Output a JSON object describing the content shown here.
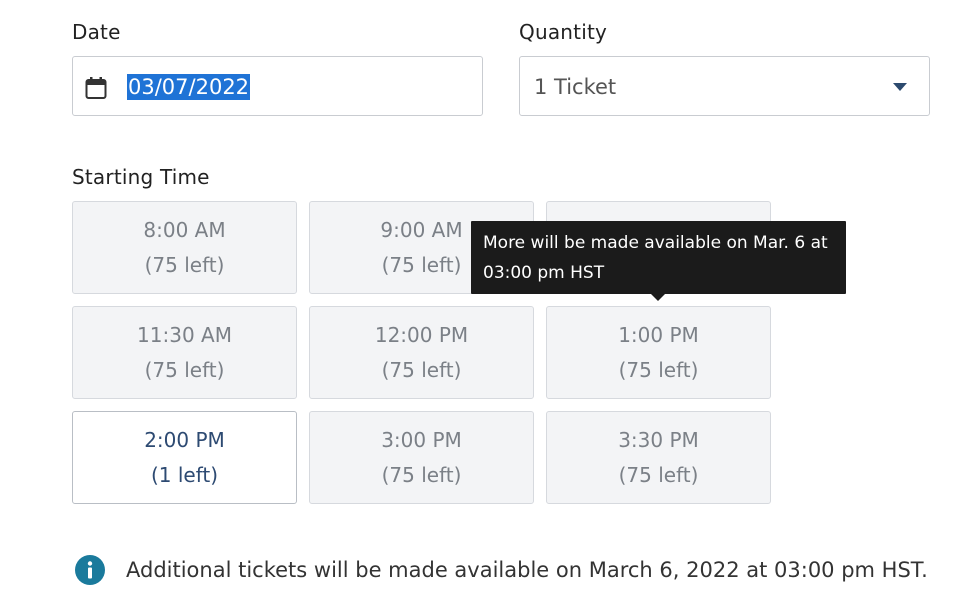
{
  "date": {
    "label": "Date",
    "value": "03/07/2022",
    "icon": "calendar-icon"
  },
  "quantity": {
    "label": "Quantity",
    "value": "1 Ticket",
    "icon": "chevron-down-icon"
  },
  "starting_time": {
    "label": "Starting Time",
    "slots": [
      {
        "time": "8:00 AM",
        "left": "(75 left)",
        "state": "disabled"
      },
      {
        "time": "9:00 AM",
        "left": "(75 left)",
        "state": "disabled"
      },
      {
        "time": "",
        "left": "",
        "state": "disabled"
      },
      {
        "time": "11:30 AM",
        "left": "(75 left)",
        "state": "disabled"
      },
      {
        "time": "12:00 PM",
        "left": "(75 left)",
        "state": "disabled"
      },
      {
        "time": "1:00 PM",
        "left": "(75 left)",
        "state": "disabled"
      },
      {
        "time": "2:00 PM",
        "left": "(1 left)",
        "state": "available"
      },
      {
        "time": "3:00 PM",
        "left": "(75 left)",
        "state": "disabled"
      },
      {
        "time": "3:30 PM",
        "left": "(75 left)",
        "state": "disabled"
      }
    ]
  },
  "tooltip": {
    "line1": "More will be made available on Mar. 6 at",
    "line2": "03:00 pm HST"
  },
  "notice": {
    "icon": "info-icon",
    "text": "Additional tickets will be made available on March 6, 2022 at 03:00 pm HST."
  },
  "colors": {
    "accent": "#1f73d6",
    "available_text": "#2d4a72",
    "disabled_text": "#7b8087",
    "info_icon": "#1a7a9c",
    "tooltip_bg": "#1b1b1b"
  }
}
